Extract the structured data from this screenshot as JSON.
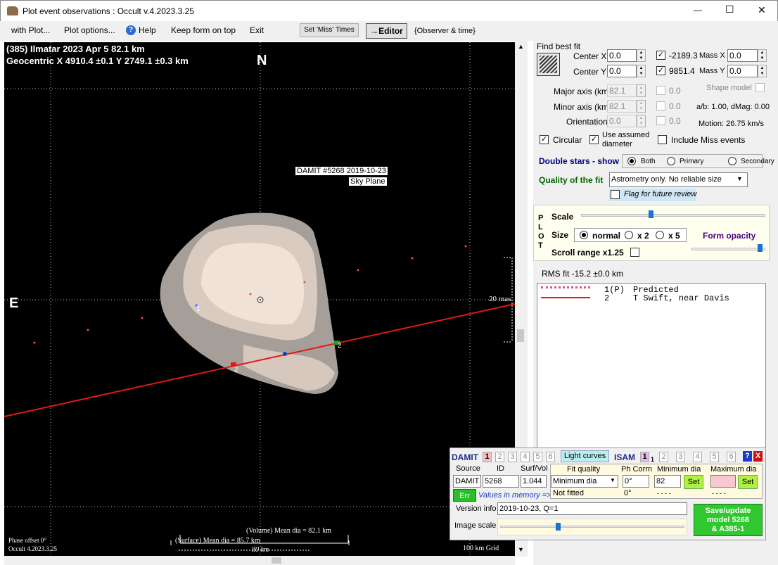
{
  "window": {
    "title": "Plot event observations : Occult v.4.2023.3.25",
    "min": "—",
    "max": "☐",
    "close": "✕"
  },
  "menu": {
    "with_plot": "with Plot...",
    "plot_options": "Plot options...",
    "help": "Help",
    "keep_on_top": "Keep form on top",
    "exit": "Exit",
    "set_miss": "Set 'Miss' Times",
    "editor": "→Editor",
    "observer_time": "{Observer & time}"
  },
  "plot": {
    "header1": "(385) Ilmatar  2023 Apr 5   82.1 km",
    "header2": "Geocentric  X  4910.4 ±0.1  Y 2749.1 ±0.3 km",
    "north": "N",
    "east": "E",
    "model_label1": "DAMIT #5268 2019-10-23",
    "model_label2": "Sky Plane",
    "scale_label": "20 mas",
    "chord1": "1",
    "chord2": "2",
    "volume_dia": "(Volume) Mean dia = 82.1 km",
    "surface_dia": "(Surface) Mean dia = 85.7 km",
    "km80": "80 km",
    "phase": "Phase offset 0°",
    "version": "Occult 4.2023.3.25",
    "grid": "100 km Grid"
  },
  "fit": {
    "find_best": "Find best fit",
    "center_x_label": "Center X",
    "center_x": "0.0",
    "center_y_label": "Center Y",
    "center_y": "0.0",
    "major_label": "Major axis (km)",
    "major": "82.1",
    "minor_label": "Minor axis (km)",
    "minor": "82.1",
    "orient_label": "Orientation",
    "orient": "0.0",
    "val1": "-2189.3",
    "val2": "9851.4",
    "val3": "0.0",
    "val4": "0.0",
    "val5": "0.0",
    "mass_x_label": "Mass X",
    "mass_x": "0.0",
    "mass_y_label": "Mass Y",
    "mass_y": "0.0",
    "shape_model": "Shape model",
    "ab": "a/b: 1.00, dMag: 0.00",
    "motion": "Motion: 26.75 km/s",
    "circular": "Circular",
    "use_assumed1": "Use assumed",
    "use_assumed2": "diameter",
    "include_miss": "Include Miss events",
    "double_stars": "Double stars - show",
    "both": "Both",
    "primary": "Primary",
    "secondary": "Secondary",
    "quality_label": "Quality of the fit",
    "quality_value": "Astrometry only. No reliable size",
    "flag": "Flag for future review"
  },
  "plotpanel": {
    "p": "P",
    "l": "L",
    "o": "O",
    "t": "T",
    "scale": "Scale",
    "size": "Size",
    "normal": "normal",
    "x2": "x 2",
    "x5": "x 5",
    "form_opacity": "Form opacity",
    "scroll_range": "Scroll range x1.25"
  },
  "rms": "RMS fit -15.2 ±0.0 km",
  "legend": [
    {
      "id": "1(P)",
      "text": "Predicted"
    },
    {
      "id": "2",
      "text": "T Swift, near Davis"
    }
  ],
  "damit": {
    "title": "DAMIT",
    "n1": "1",
    "n2": "2",
    "n3": "3",
    "n4": "4",
    "n5": "5",
    "n6": "6",
    "light_curves": "Light curves",
    "isam": "ISAM",
    "i1": "1",
    "i1sub": "1",
    "i2": "2",
    "i3": "3",
    "i4": "4",
    "i5": "5",
    "i6": "6",
    "help": "?",
    "close": "X",
    "source_label": "Source",
    "id_label": "ID",
    "surf_label": "Surf/Vol",
    "source": "DAMIT",
    "id": "5268",
    "surf": "1.044",
    "err": "Err",
    "values_mem": "Values in memory =>",
    "fitq_label": "Fit quality",
    "fitq": "Minimum dia",
    "not_fitted": "Not fitted",
    "ph_label": "Ph Corrn",
    "ph": "0°",
    "ph2": "0°",
    "min_label": "Minimum dia",
    "min": "82",
    "min_dash": "- - - -",
    "max_label": "Maximum dia",
    "max": "",
    "max_dash": "- - - -",
    "set": "Set",
    "version_label": "Version info",
    "version": "2019-10-23, Q=1",
    "image_scale": "Image scale",
    "save1": "Save/update",
    "save2": "model 5268",
    "save3": "& A385-1"
  }
}
